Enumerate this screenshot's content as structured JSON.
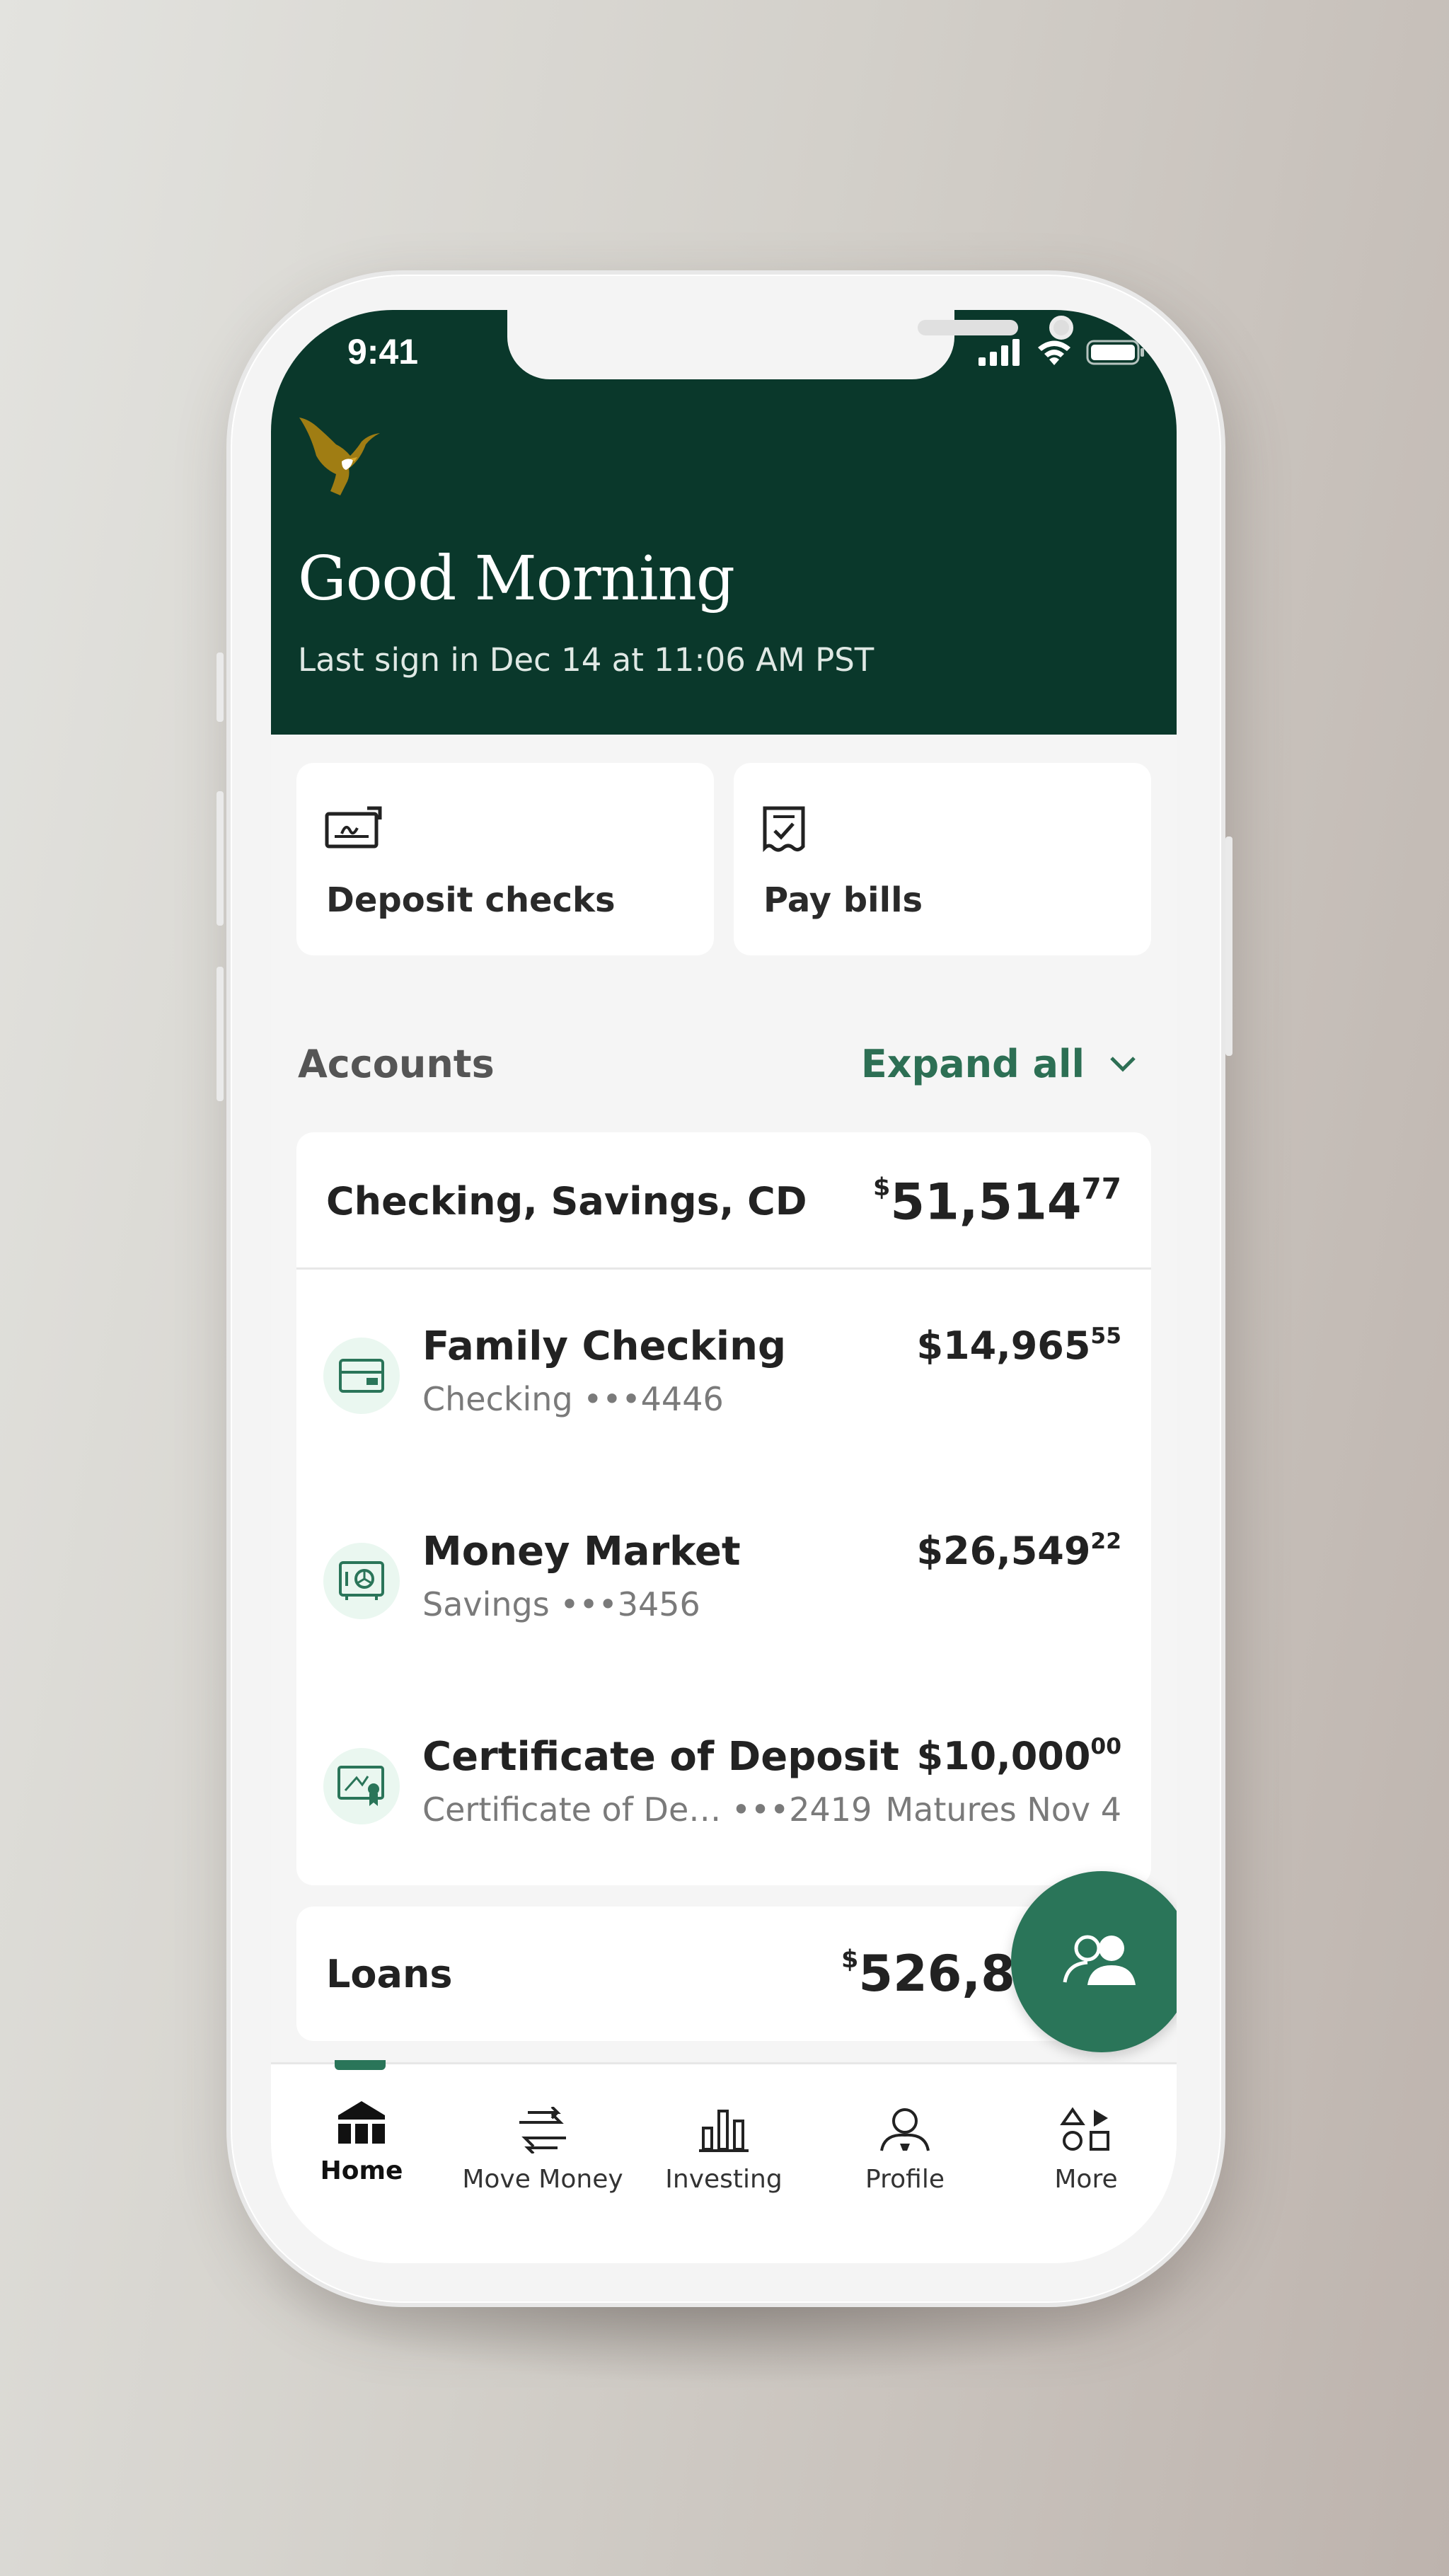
{
  "status_bar": {
    "time": "9:41"
  },
  "header": {
    "greeting": "Good Morning",
    "last_signin": "Last sign in Dec 14 at 11:06 AM PST"
  },
  "quick_actions": [
    {
      "label": "Deposit checks",
      "icon": "check-deposit-icon"
    },
    {
      "label": "Pay bills",
      "icon": "bill-icon"
    }
  ],
  "accounts": {
    "title": "Accounts",
    "expand_label": "Expand all",
    "group": {
      "title": "Checking, Savings, CD",
      "total_currency": "$",
      "total_whole": "51,514",
      "total_cents": "77"
    },
    "items": [
      {
        "name": "Family Checking",
        "sub": "Checking •••4446",
        "amount_whole": "$14,965",
        "amount_cents": "55",
        "icon": "card-icon"
      },
      {
        "name": "Money Market",
        "sub": "Savings •••3456",
        "amount_whole": "$26,549",
        "amount_cents": "22",
        "icon": "safe-icon"
      },
      {
        "name": "Certificate of Deposit",
        "sub": "Certificate of De… •••2419",
        "amount_whole": "$10,000",
        "amount_cents": "00",
        "note": "Matures Nov 4",
        "icon": "certificate-icon"
      }
    ],
    "loans": {
      "title": "Loans",
      "total_currency": "$",
      "total_whole": "526,8"
    }
  },
  "tabs": [
    {
      "label": "Home",
      "icon": "home-icon",
      "active": true
    },
    {
      "label": "Move Money",
      "icon": "transfer-icon"
    },
    {
      "label": "Investing",
      "icon": "bar-chart-icon"
    },
    {
      "label": "Profile",
      "icon": "profile-icon"
    },
    {
      "label": "More",
      "icon": "more-icon"
    }
  ],
  "colors": {
    "header_green": "#0a382b",
    "accent_green": "#2a7559",
    "logo_gold": "#a07d13"
  }
}
